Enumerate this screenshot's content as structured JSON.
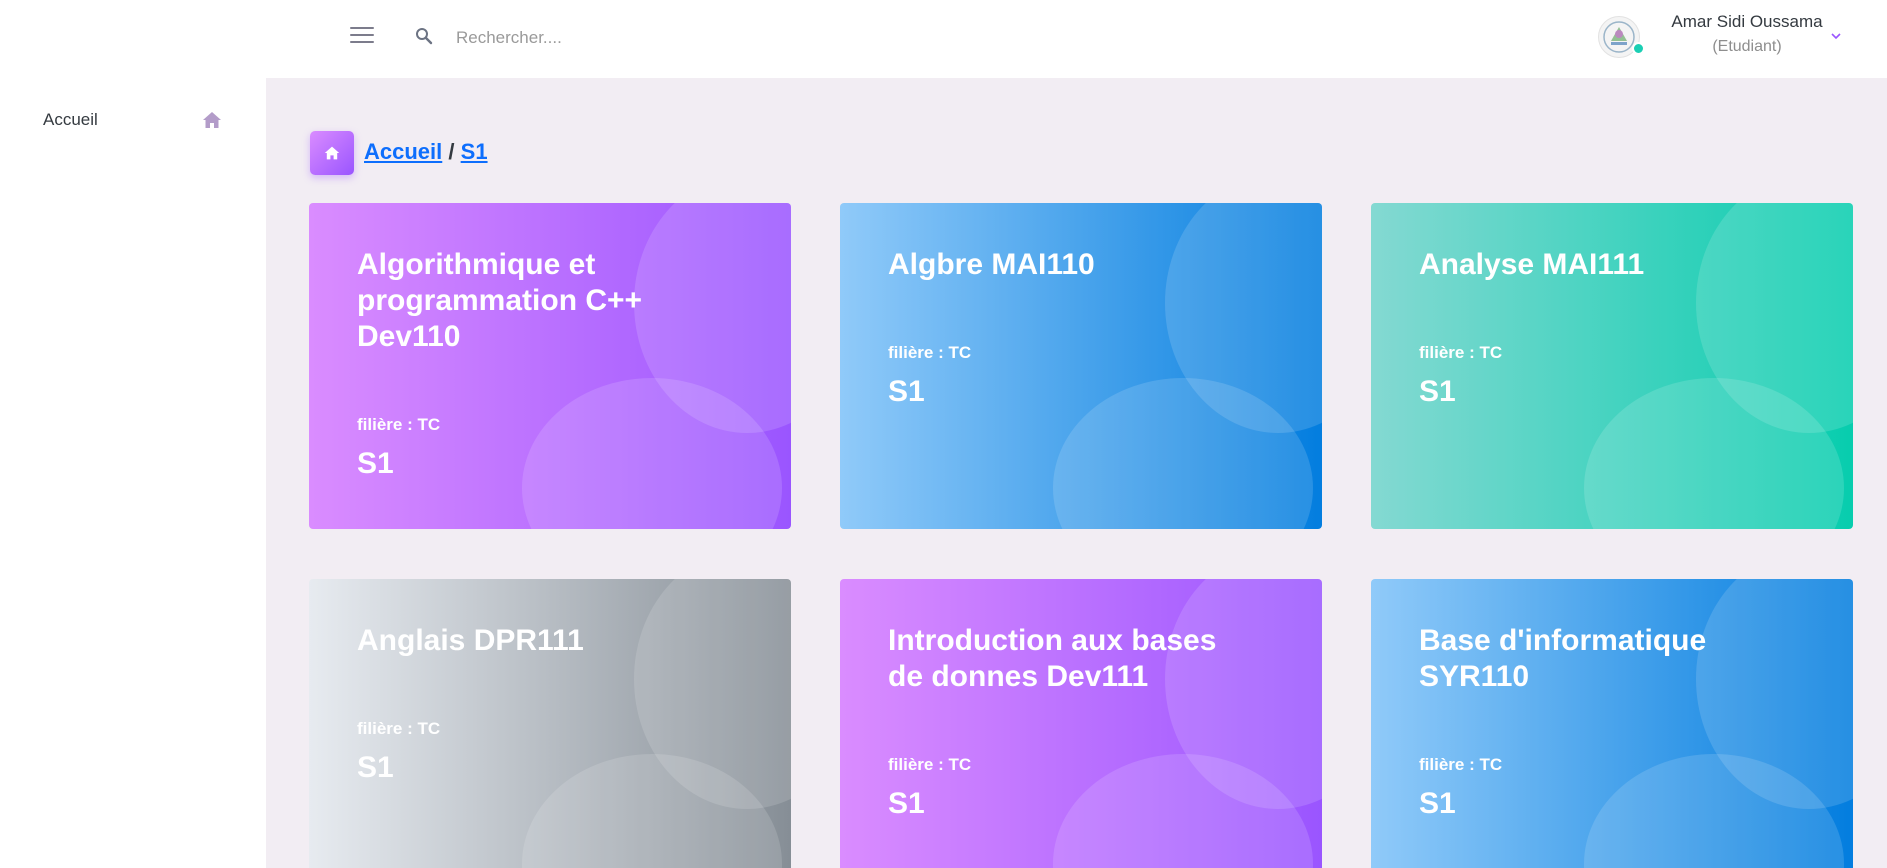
{
  "header": {
    "search_placeholder": "Rechercher....",
    "user_name": "Amar Sidi Oussama",
    "user_role": "(Etudiant)"
  },
  "sidebar": {
    "items": [
      {
        "label": "Accueil",
        "icon": "home-icon"
      }
    ]
  },
  "breadcrumb": {
    "home": "Accueil",
    "separator": "/",
    "current": "S1"
  },
  "courses": [
    {
      "title": "Algorithmique et programmation C++ Dev110",
      "filiere": "filière : TC",
      "semester": "S1",
      "color": "#9a55ff"
    },
    {
      "title": "Algbre MAI110",
      "filiere": "filière : TC",
      "semester": "S1",
      "color": "#047edf"
    },
    {
      "title": "Analyse MAI111",
      "filiere": "filière : TC",
      "semester": "S1",
      "color": "#07cdae"
    },
    {
      "title": "Anglais DPR111",
      "filiere": "filière : TC",
      "semester": "S1",
      "color": "#868e96"
    },
    {
      "title": "Introduction aux bases de donnes Dev111",
      "filiere": "filière : TC",
      "semester": "S1",
      "color": "#9a55ff"
    },
    {
      "title": "Base d'informatique SYR110",
      "filiere": "filière : TC",
      "semester": "S1",
      "color": "#047edf"
    }
  ],
  "colors": {
    "accent": "#9a55ff",
    "online": "#1bcfb4",
    "page_background": "#f2edf3"
  }
}
